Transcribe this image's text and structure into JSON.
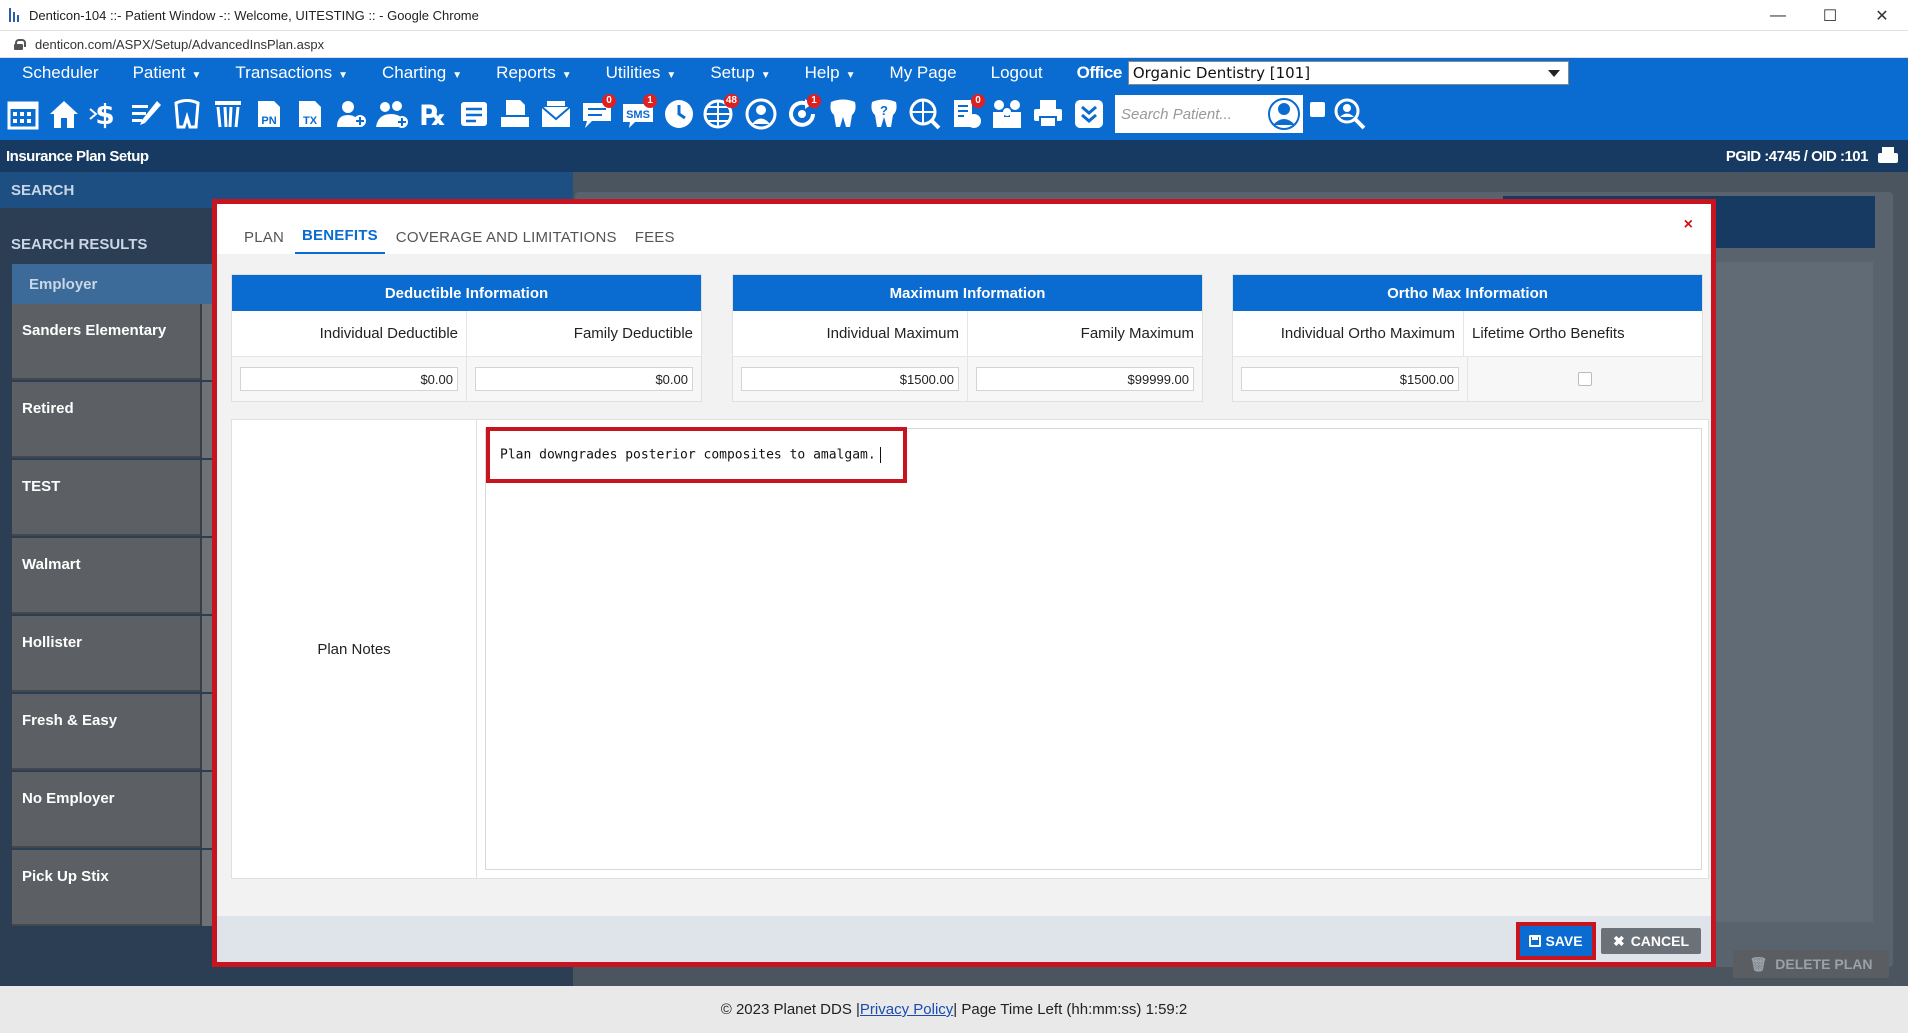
{
  "browser": {
    "title": "Denticon-104 ::- Patient Window -:: Welcome, UITESTING :: - Google Chrome",
    "url": "denticon.com/ASPX/Setup/AdvancedInsPlan.aspx",
    "min": "—",
    "max": "☐",
    "close": "✕"
  },
  "menu": {
    "items": [
      {
        "label": "Scheduler",
        "caret": ""
      },
      {
        "label": "Patient",
        "caret": "▼"
      },
      {
        "label": "Transactions",
        "caret": "▼"
      },
      {
        "label": "Charting",
        "caret": "▼"
      },
      {
        "label": "Reports",
        "caret": "▼"
      },
      {
        "label": "Utilities",
        "caret": "▼"
      },
      {
        "label": "Setup",
        "caret": "▼"
      },
      {
        "label": "Help",
        "caret": "▼"
      },
      {
        "label": "My Page",
        "caret": ""
      },
      {
        "label": "Logout",
        "caret": ""
      }
    ],
    "office_label": "Office",
    "office_value": "Organic Dentistry [101]"
  },
  "toolbar": {
    "search_placeholder": "Search Patient...",
    "badges": {
      "sms": "1",
      "msg": "0",
      "web": "48",
      "sync": "1",
      "doc": "0"
    },
    "labels": {
      "pn": "PN",
      "tx": "TX",
      "rx": "℞",
      "sms": "SMS"
    }
  },
  "section": {
    "title": "Insurance Plan Setup",
    "ids": "PGID :4745  /  OID :101"
  },
  "background": {
    "search": "SEARCH",
    "results": "SEARCH RESULTS",
    "employer_header": "Employer",
    "employers": [
      "Sanders Elementary",
      "Retired",
      "TEST",
      "Walmart",
      "Hollister",
      "Fresh & Easy",
      "No Employer",
      "Pick Up Stix"
    ],
    "delete_plan": "DELETE PLAN"
  },
  "modal": {
    "tabs": [
      "PLAN",
      "BENEFITS",
      "COVERAGE AND LIMITATIONS",
      "FEES"
    ],
    "active_tab": "BENEFITS",
    "close": "×",
    "deductible": {
      "header": "Deductible Information",
      "col1": "Individual Deductible",
      "col2": "Family Deductible",
      "val1": "$0.00",
      "val2": "$0.00"
    },
    "maximum": {
      "header": "Maximum Information",
      "col1": "Individual Maximum",
      "col2": "Family Maximum",
      "val1": "$1500.00",
      "val2": "$99999.00"
    },
    "ortho": {
      "header": "Ortho Max Information",
      "col1": "Individual Ortho Maximum",
      "col2": "Lifetime Ortho Benefits",
      "val1": "$1500.00",
      "lifetime_checked": false
    },
    "notes": {
      "label": "Plan Notes",
      "text": "Plan downgrades posterior composites to amalgam."
    },
    "save": "SAVE",
    "cancel": "CANCEL"
  },
  "footer": {
    "copyright": "© 2023 Planet DDS | ",
    "privacy": "Privacy Policy",
    "time_left": " |  Page Time Left (hh:mm:ss) 1:59:2"
  }
}
